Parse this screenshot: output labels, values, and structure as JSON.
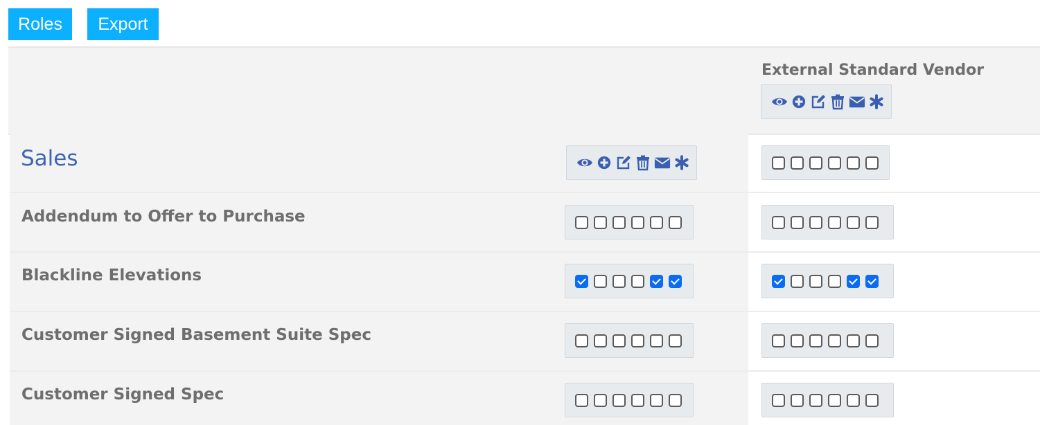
{
  "toolbar": {
    "roles_label": "Roles",
    "export_label": "Export"
  },
  "role_column": {
    "title": "External Standard Vendor",
    "permission_icons": [
      "eye-icon",
      "plus-circle-icon",
      "edit-icon",
      "trash-icon",
      "envelope-icon",
      "asterisk-icon"
    ]
  },
  "section": {
    "label": "Sales"
  },
  "rows": [
    {
      "label": "Addendum to Offer to Purchase",
      "left": [
        false,
        false,
        false,
        false,
        false,
        false
      ],
      "right": [
        false,
        false,
        false,
        false,
        false,
        false
      ]
    },
    {
      "label": "Blackline Elevations",
      "left": [
        true,
        false,
        false,
        false,
        true,
        true
      ],
      "right": [
        true,
        false,
        false,
        false,
        true,
        true
      ]
    },
    {
      "label": "Customer Signed Basement Suite Spec",
      "left": [
        false,
        false,
        false,
        false,
        false,
        false
      ],
      "right": [
        false,
        false,
        false,
        false,
        false,
        false
      ]
    },
    {
      "label": "Customer Signed Spec",
      "left": [
        false,
        false,
        false,
        false,
        false,
        false
      ],
      "right": [
        false,
        false,
        false,
        false,
        false,
        false
      ]
    }
  ],
  "sales_right": [
    false,
    false,
    false,
    false,
    false,
    false
  ],
  "colors": {
    "accent": "#0cb0ff",
    "icon": "#3a5fb0",
    "checked": "#0b6cf2",
    "label": "#6e6e6e",
    "section": "#3f64b4"
  }
}
